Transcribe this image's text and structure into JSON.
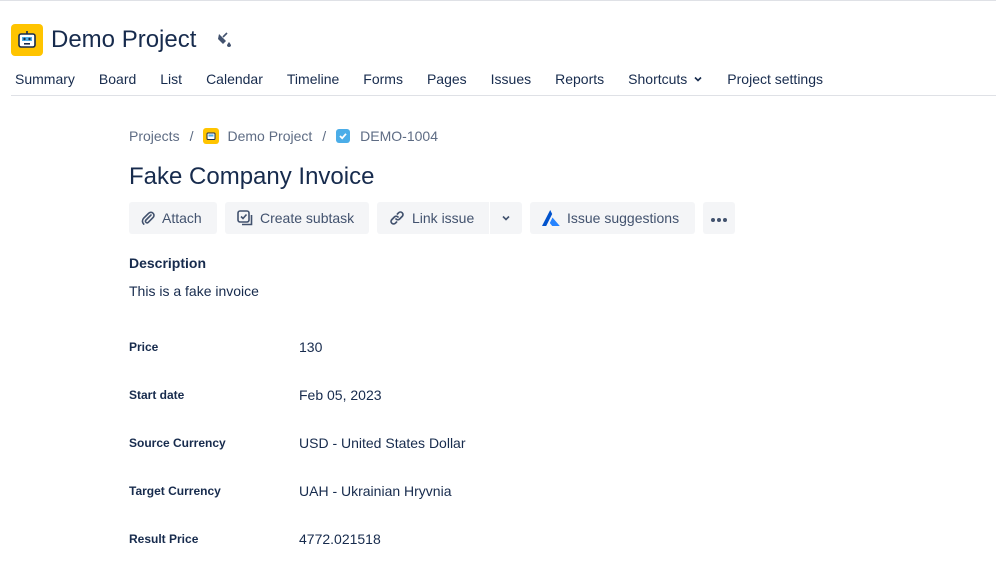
{
  "project": {
    "title": "Demo Project"
  },
  "tabs": [
    {
      "label": "Summary"
    },
    {
      "label": "Board"
    },
    {
      "label": "List"
    },
    {
      "label": "Calendar"
    },
    {
      "label": "Timeline"
    },
    {
      "label": "Forms"
    },
    {
      "label": "Pages"
    },
    {
      "label": "Issues"
    },
    {
      "label": "Reports"
    },
    {
      "label": "Shortcuts"
    },
    {
      "label": "Project settings"
    }
  ],
  "breadcrumb": {
    "projects": "Projects",
    "separator": "/",
    "project": "Demo Project",
    "issue_key": "DEMO-1004"
  },
  "issue": {
    "title": "Fake Company Invoice"
  },
  "toolbar": {
    "attach": "Attach",
    "create_subtask": "Create subtask",
    "link_issue": "Link issue",
    "issue_suggestions": "Issue suggestions"
  },
  "description": {
    "label": "Description",
    "text": "This is a fake invoice"
  },
  "fields": [
    {
      "label": "Price",
      "value": "130"
    },
    {
      "label": "Start date",
      "value": "Feb 05, 2023"
    },
    {
      "label": "Source Currency",
      "value": "USD - United States Dollar"
    },
    {
      "label": "Target Currency",
      "value": "UAH - Ukrainian Hryvnia"
    },
    {
      "label": "Result Price",
      "value": "4772.021518"
    }
  ],
  "icons": {
    "project_avatar": "robot-avatar-icon",
    "paint": "paint-bucket-icon",
    "task": "task-checkbox-icon",
    "attach": "paperclip-icon",
    "subtask": "subtask-icon",
    "link": "link-icon",
    "suggestions": "atlassian-intelligence-icon",
    "more": "more-horizontal-icon"
  },
  "colors": {
    "avatar": "#ffc400",
    "task": "#4bade8",
    "text": "#172b4d",
    "button_bg": "#f4f5f7",
    "accent": "#0052cc"
  }
}
